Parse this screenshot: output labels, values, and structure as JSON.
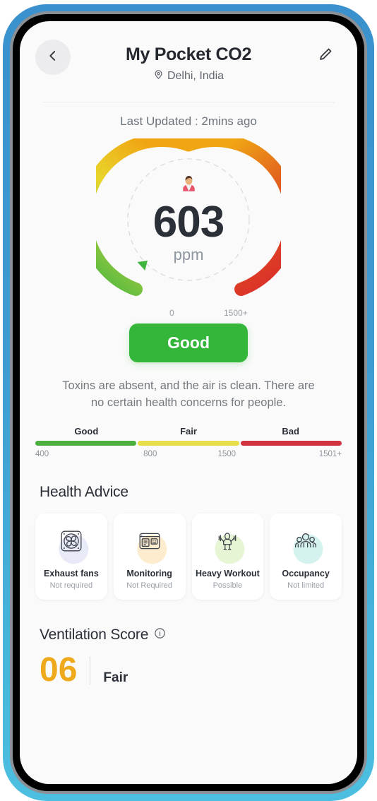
{
  "header": {
    "title": "My Pocket CO2",
    "location": "Delhi, India",
    "back_icon": "chevron-left-icon",
    "edit_icon": "pencil-icon",
    "location_icon": "map-pin-icon",
    "last_updated": "Last Updated : 2mins ago"
  },
  "gauge": {
    "value": "603",
    "unit": "ppm",
    "min_label": "0",
    "max_label": "1500+",
    "person_icon": "person-emoji",
    "needle_color": "#3fb53f",
    "arc_colors": [
      "#3fb53f",
      "#95c93d",
      "#e8d62c",
      "#f0a513",
      "#e2621f",
      "#d9252b"
    ],
    "value_numeric": 603,
    "range_min": 0,
    "range_max": 1500
  },
  "status": {
    "label": "Good",
    "color": "#33b63a",
    "description": "Toxins are absent, and the air is clean. There are no certain health concerns for people."
  },
  "scale": {
    "labels": [
      "Good",
      "Fair",
      "Bad"
    ],
    "colors": [
      "#4caf3f",
      "#e8dd4a",
      "#d0333f"
    ],
    "ticks": [
      "400",
      "800",
      "1500",
      "1501+"
    ]
  },
  "health_advice": {
    "title": "Health Advice",
    "cards": [
      {
        "label": "Exhaust fans",
        "sub": "Not required",
        "icon": "exhaust-fan-icon",
        "blob": "#e8eaf8"
      },
      {
        "label": "Monitoring",
        "sub": "Not Required",
        "icon": "monitor-screen-icon",
        "blob": "#fdeccd"
      },
      {
        "label": "Heavy Workout",
        "sub": "Possible",
        "icon": "weightlifting-icon",
        "blob": "#e6f5d4"
      },
      {
        "label": "Occupancy",
        "sub": "Not limited",
        "icon": "people-group-icon",
        "blob": "#d4f3ee"
      }
    ]
  },
  "ventilation": {
    "title": "Ventilation Score",
    "info_icon": "info-circle-icon",
    "score": "06",
    "status": "Fair",
    "score_color": "#eeaa1c"
  }
}
